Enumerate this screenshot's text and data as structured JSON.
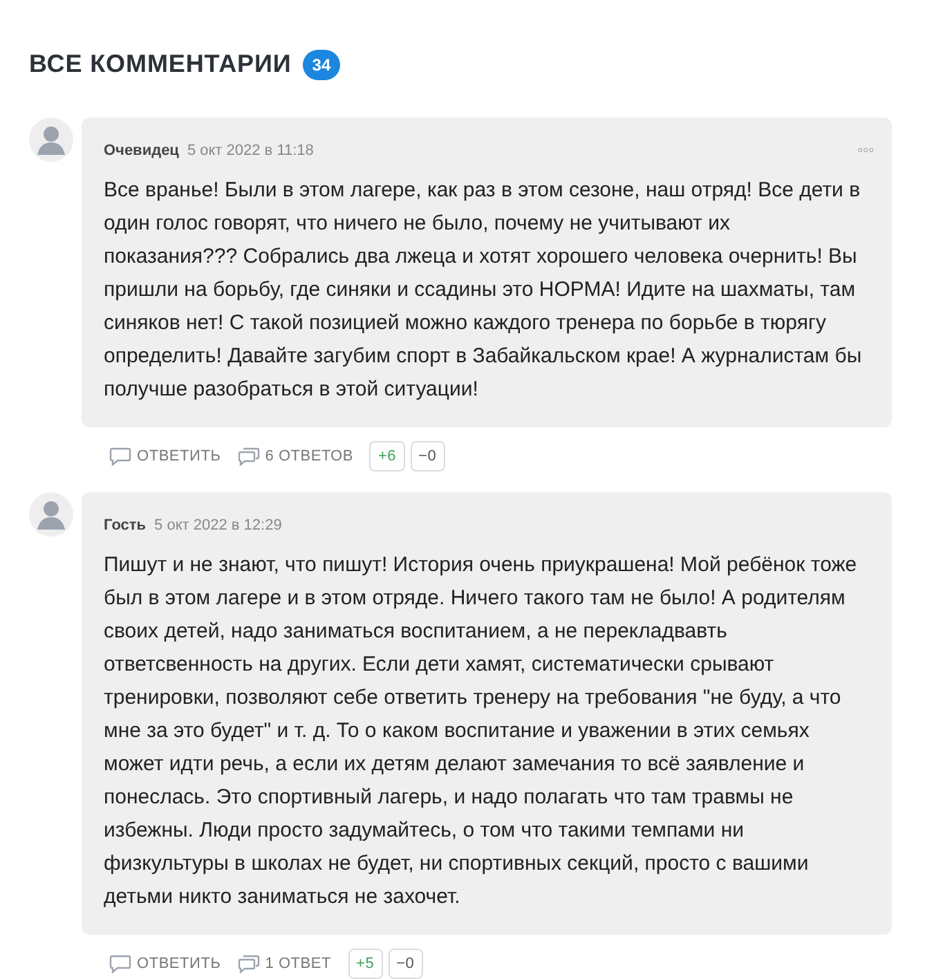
{
  "heading": {
    "title": "ВСЕ КОММЕНТАРИИ",
    "count": "34"
  },
  "comments": [
    {
      "author": "Очевидец",
      "date": "5 окт 2022 в 11:18",
      "menu": "∘∘∘",
      "text": "Все вранье! Были в этом лагере, как раз в этом сезоне, наш отряд! Все дети в один голос говорят, что ничего не было, почему не учитывают их показания??? Собрались два лжеца и хотят хорошего человека очернить! Вы пришли на борьбу, где синяки и ссадины это НОРМА! Идите на шахматы, там синяков нет! С такой позицией можно каждого тренера по борьбе в тюрягу определить! Давайте загубим спорт в Забайкальском крае! А журналистам бы получше разобраться в этой ситуации!",
      "reply": "ОТВЕТИТЬ",
      "replies": "6 ОТВЕТОВ",
      "plus": "+6",
      "minus": "−0"
    },
    {
      "author": "Гость",
      "date": "5 окт 2022 в 12:29",
      "text": "Пишут и не знают, что пишут! История очень приукрашена! Мой ребёнок тоже был в этом лагере и в этом отряде. Ничего такого там не было! А родителям своих детей, надо заниматься воспитанием, а не перекладвавть ответсвенность на других. Если дети хамят, систематически срывают тренировки, позволяют себе ответить тренеру на требования \"не буду, а что мне за это будет\" и т. д. То о каком воспитание и уважении в этих семьях может идти речь, а если их детям делают замечания то всё заявление и понеслась. Это спортивный лагерь, и надо полагать что там травмы не избежны. Люди просто задумайтесь, о том что такими темпами ни физкультуры в школах не будет, ни спортивных секций, просто с вашими детьми никто заниматься не захочет.",
      "reply": "ОТВЕТИТЬ",
      "replies": "1 ОТВЕТ",
      "plus": "+5",
      "minus": "−0"
    }
  ]
}
